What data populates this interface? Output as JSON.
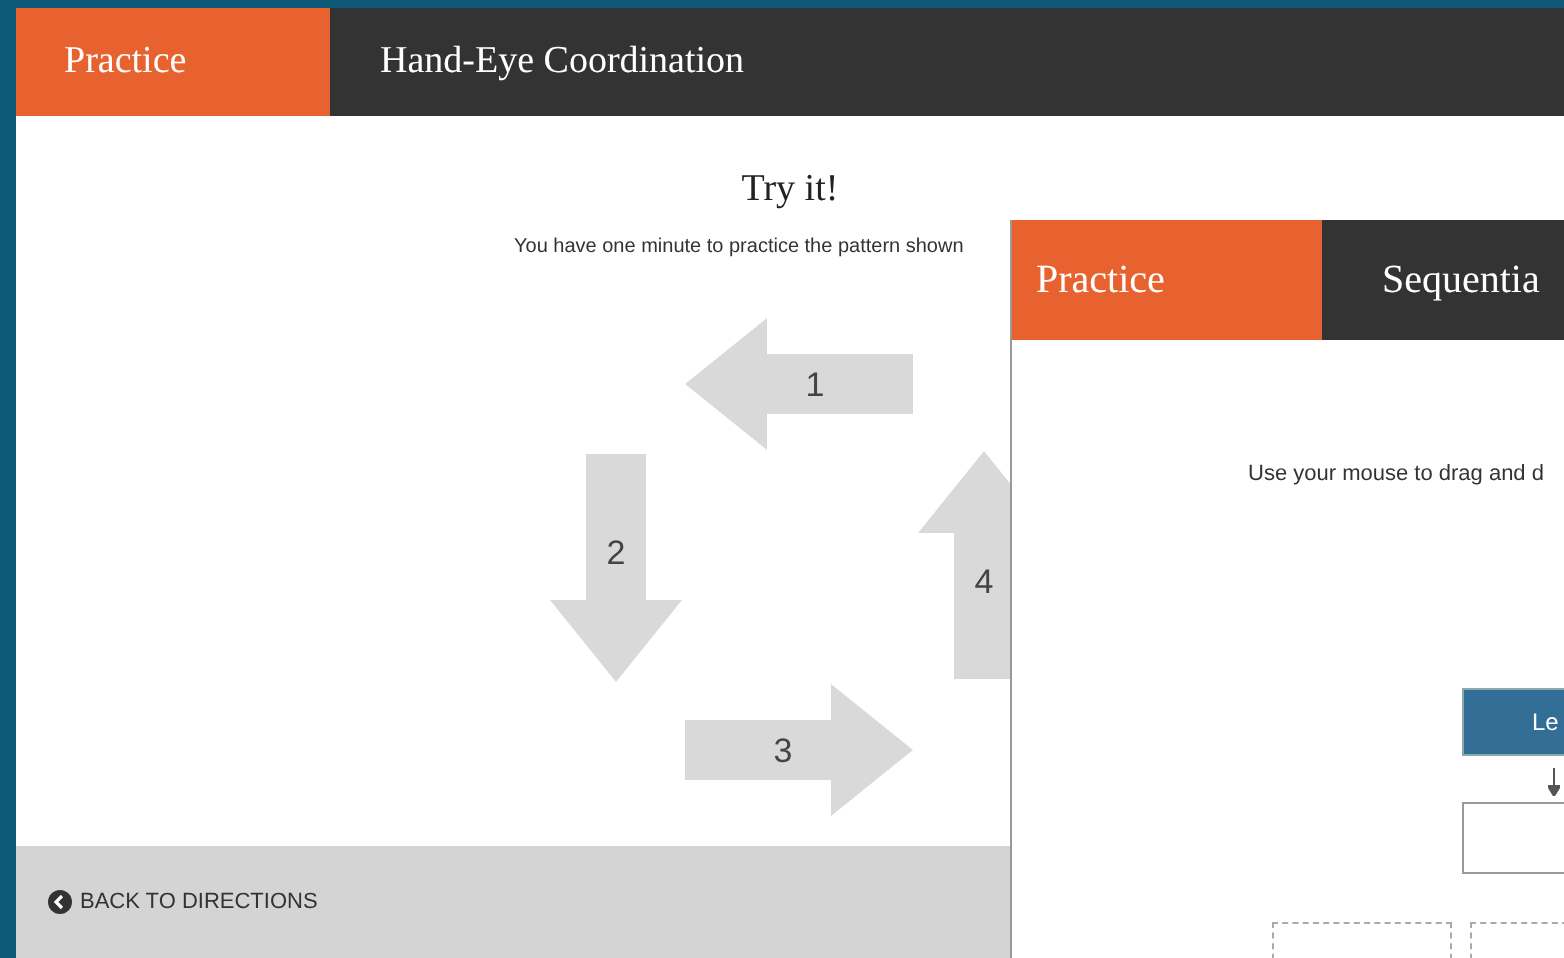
{
  "main_window": {
    "tab": "Practice",
    "title": "Hand-Eye Coordination",
    "heading": "Try it!",
    "instruction": "You have one minute to practice the pattern shown",
    "arrows": [
      {
        "number": "1",
        "kind": "left"
      },
      {
        "number": "2",
        "kind": "down"
      },
      {
        "number": "3",
        "kind": "right"
      },
      {
        "number": "4",
        "kind": "up"
      }
    ],
    "back_link": "BACK TO DIRECTIONS"
  },
  "front_window": {
    "tab": "Practice",
    "title": "Sequentia",
    "instruction": "Use your mouse to drag and d",
    "button": "Le"
  }
}
